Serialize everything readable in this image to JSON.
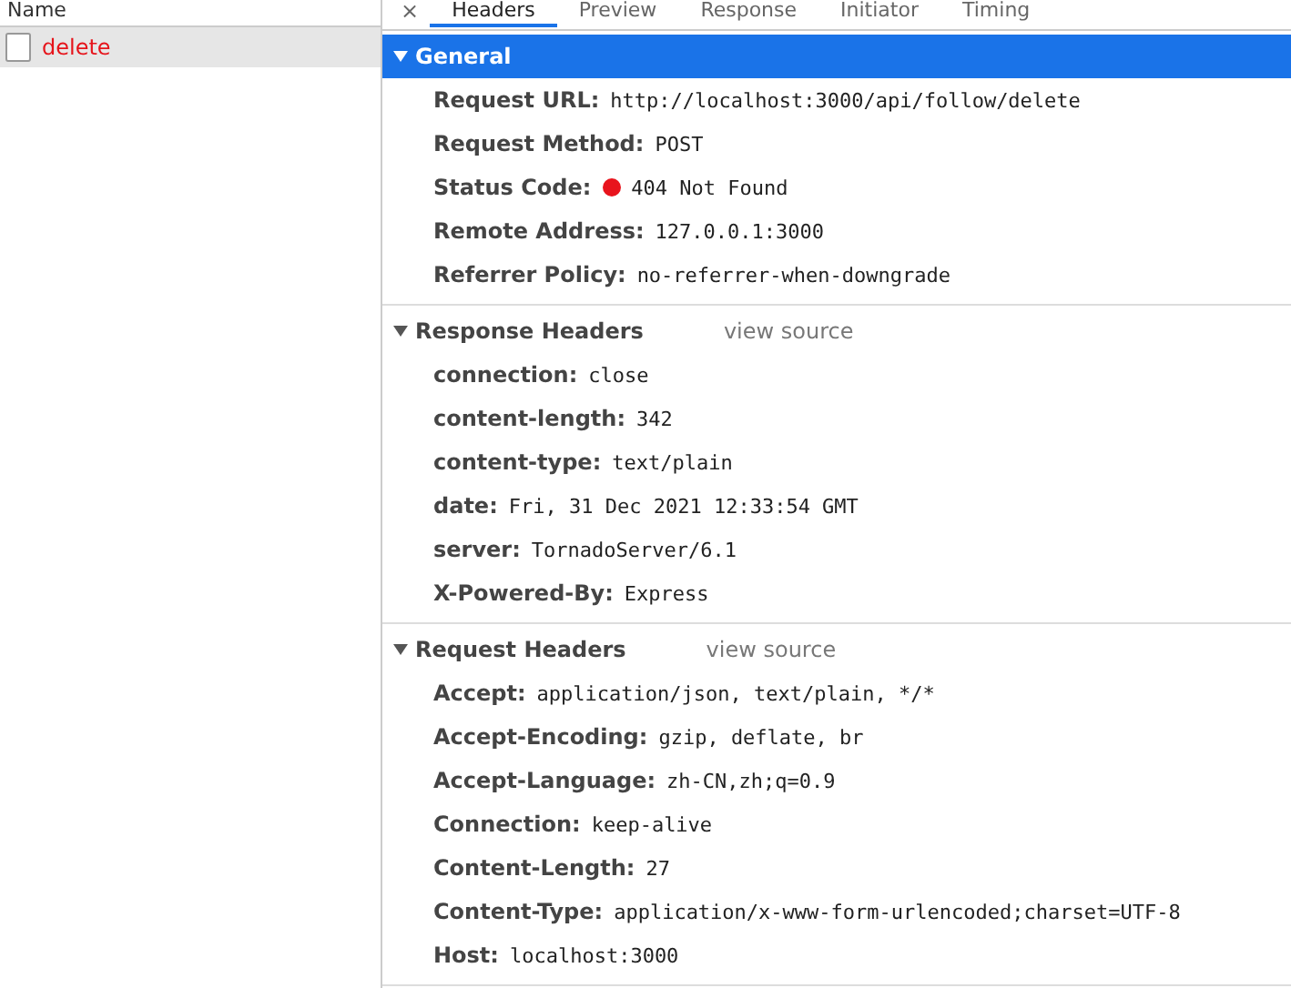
{
  "request_list": {
    "column": "Name",
    "items": [
      {
        "name": "delete",
        "selected": true,
        "failed": true
      }
    ]
  },
  "close_button": "×",
  "tabs": [
    {
      "label": "Headers",
      "kind": "tab",
      "selected": true
    },
    {
      "label": "Preview",
      "kind": "tab",
      "selected": false
    },
    {
      "label": "Response",
      "kind": "tab",
      "selected": false
    },
    {
      "label": "Initiator",
      "kind": "tab",
      "selected": false
    },
    {
      "label": "Timing",
      "kind": "tab",
      "selected": false
    }
  ],
  "sections": [
    {
      "title": "General",
      "expanded": true,
      "highlighted": true,
      "rows": [
        {
          "name": "Request URL:",
          "value": "http://localhost:3000/api/follow/delete"
        },
        {
          "name": "Request Method:",
          "value": "POST"
        },
        {
          "name": "Status Code:",
          "value": "404 Not Found",
          "color": "#e8141d"
        },
        {
          "name": "Remote Address:",
          "value": "127.0.0.1:3000"
        },
        {
          "name": "Referrer Policy:",
          "value": "no-referrer-when-downgrade"
        }
      ]
    },
    {
      "title": "Response Headers",
      "link": "view source",
      "expanded": true,
      "highlighted": false,
      "rows": [
        {
          "name": "connection:",
          "value": "close"
        },
        {
          "name": "content-length:",
          "value": "342"
        },
        {
          "name": "content-type:",
          "value": "text/plain"
        },
        {
          "name": "date:",
          "value": "Fri, 31 Dec 2021 12:33:54 GMT"
        },
        {
          "name": "server:",
          "value": "TornadoServer/6.1"
        },
        {
          "name": "X-Powered-By:",
          "value": "Express"
        }
      ]
    },
    {
      "title": "Request Headers",
      "link": "view source",
      "expanded": true,
      "highlighted": false,
      "rows": [
        {
          "name": "Accept:",
          "value": "application/json, text/plain, */*"
        },
        {
          "name": "Accept-Encoding:",
          "value": "gzip, deflate, br"
        },
        {
          "name": "Accept-Language:",
          "value": "zh-CN,zh;q=0.9"
        },
        {
          "name": "Connection:",
          "value": "keep-alive"
        },
        {
          "name": "Content-Length:",
          "value": "27"
        },
        {
          "name": "Content-Type:",
          "value": "application/x-www-form-urlencoded;charset=UTF-8"
        },
        {
          "name": "Host:",
          "value": "localhost:3000"
        }
      ]
    }
  ]
}
